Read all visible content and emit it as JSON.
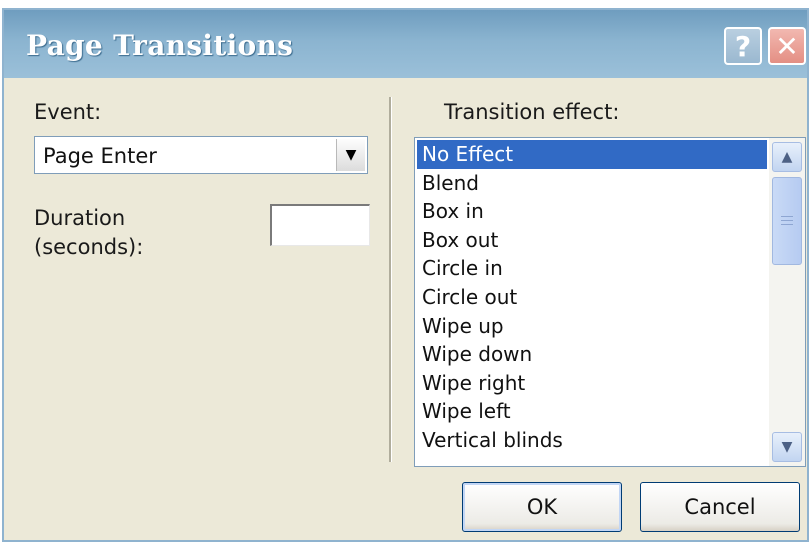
{
  "dialog": {
    "title": "Page Transitions",
    "help_icon": "question-icon",
    "close_icon": "close-icon"
  },
  "event": {
    "label": "Event:",
    "selected": "Page Enter"
  },
  "duration": {
    "label_line1": "Duration",
    "label_line2": "(seconds):",
    "value": ""
  },
  "transitions": {
    "label": "Transition effect:",
    "items": [
      "No Effect",
      "Blend",
      "Box in",
      "Box out",
      "Circle in",
      "Circle out",
      "Wipe up",
      "Wipe down",
      "Wipe right",
      "Wipe left",
      "Vertical blinds"
    ],
    "selected": "No Effect"
  },
  "buttons": {
    "ok": "OK",
    "cancel": "Cancel"
  },
  "colors": {
    "titlebar": "#7fa9c8",
    "selection": "#316ac5",
    "dialog_bg": "#ece9d8"
  }
}
